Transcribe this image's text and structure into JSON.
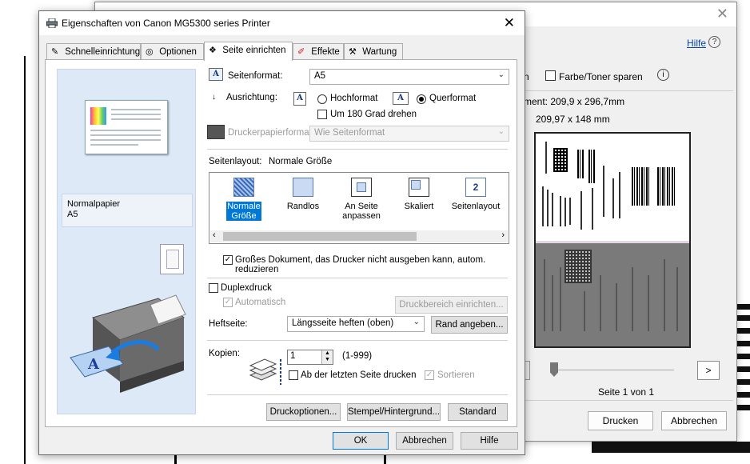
{
  "back_window": {
    "help_link": "Hilfe",
    "help_icon": "?",
    "partial_label": "n",
    "save_toner_label": "Farbe/Toner sparen",
    "info_icon": "i",
    "dimension_line1": "ment: 209,9 x 296,7mm",
    "dimension_line2": "209,97 x 148 mm",
    "next_page_label": ">",
    "page_indicator": "Seite 1 von 1",
    "print_button": "Drucken",
    "cancel_button": "Abbrechen",
    "close_icon": "✕"
  },
  "dialog": {
    "title": "Eigenschaften von Canon MG5300 series Printer",
    "close_icon": "✕",
    "tabs": [
      {
        "label": "Schnelleinrichtung",
        "icon": "quick-setup-icon"
      },
      {
        "label": "Optionen",
        "icon": "options-icon"
      },
      {
        "label": "Seite einrichten",
        "icon": "page-setup-icon"
      },
      {
        "label": "Effekte",
        "icon": "effects-icon"
      },
      {
        "label": "Wartung",
        "icon": "maintenance-icon"
      }
    ],
    "left_pane": {
      "media_type": "Normalpapier",
      "paper_size": "A5"
    },
    "page_size_label": "Seitenformat:",
    "page_size_value": "A5",
    "orientation_label": "Ausrichtung:",
    "orientation_options": [
      "Hochformat",
      "Querformat"
    ],
    "orientation_selected": "Querformat",
    "rotate_label": "Um 180 Grad drehen",
    "printer_paper_label": "Druckerpapierformat:",
    "printer_paper_value": "Wie Seitenformat",
    "layout_label": "Seitenlayout:",
    "layout_value": "Normale Größe",
    "layout_items": [
      {
        "line1": "Normale",
        "line2": "Größe"
      },
      {
        "line1": "Randlos",
        "line2": ""
      },
      {
        "line1": "An Seite",
        "line2": "anpassen"
      },
      {
        "line1": "Skaliert",
        "line2": ""
      },
      {
        "line1": "Seitenlayout",
        "line2": ""
      }
    ],
    "layout_icon_page_number": "2",
    "large_doc_label": "Großes Dokument, das Drucker nicht ausgeben kann, autom. reduzieren",
    "duplex_label": "Duplexdruck",
    "automatic_label": "Automatisch",
    "print_area_button": "Druckbereich einrichten...",
    "staple_label": "Heftseite:",
    "staple_value": "Längsseite heften (oben)",
    "margin_button": "Rand angeben...",
    "copies_label": "Kopien:",
    "copies_value": "1",
    "copies_range": "(1-999)",
    "reverse_label": "Ab der letzten Seite drucken",
    "collate_label": "Sortieren",
    "print_options_button": "Druckoptionen...",
    "stamp_button": "Stempel/Hintergrund...",
    "default_button": "Standard",
    "ok_button": "OK",
    "cancel_button": "Abbrechen",
    "help_button": "Hilfe"
  }
}
